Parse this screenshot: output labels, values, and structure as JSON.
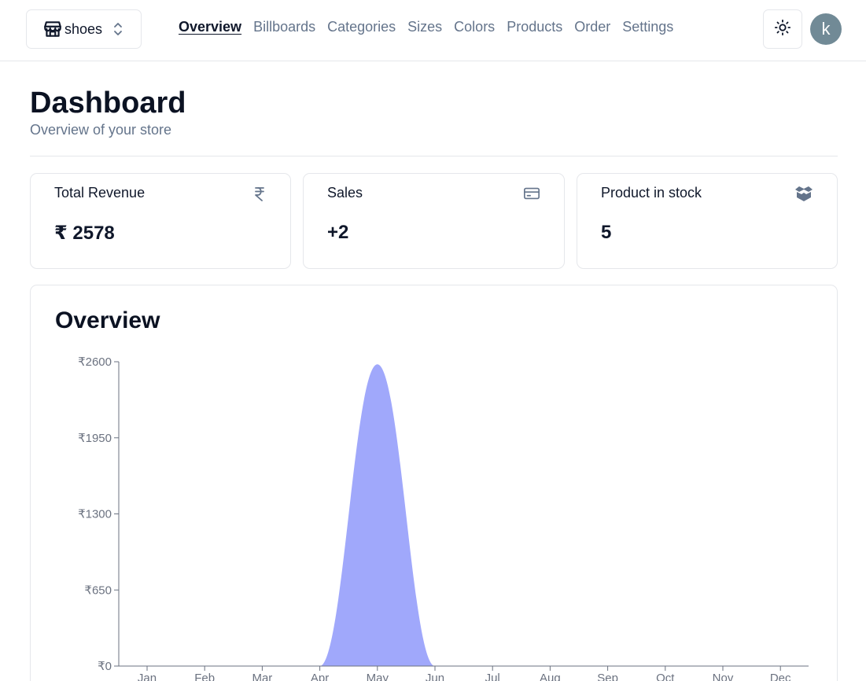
{
  "store_switcher": {
    "name": "shoes",
    "icon": "store-icon"
  },
  "nav": {
    "items": [
      {
        "label": "Overview",
        "active": true
      },
      {
        "label": "Billboards",
        "active": false
      },
      {
        "label": "Categories",
        "active": false
      },
      {
        "label": "Sizes",
        "active": false
      },
      {
        "label": "Colors",
        "active": false
      },
      {
        "label": "Products",
        "active": false
      },
      {
        "label": "Order",
        "active": false
      },
      {
        "label": "Settings",
        "active": false
      }
    ]
  },
  "user": {
    "avatar_letter": "k"
  },
  "header": {
    "title": "Dashboard",
    "subtitle": "Overview of your store"
  },
  "cards": [
    {
      "title": "Total Revenue",
      "value": "₹ 2578",
      "icon": "rupee-icon"
    },
    {
      "title": "Sales",
      "value": "+2",
      "icon": "credit-card-icon"
    },
    {
      "title": "Product in stock",
      "value": "5",
      "icon": "package-icon"
    }
  ],
  "overview": {
    "title": "Overview"
  },
  "chart_data": {
    "type": "area",
    "title": "Overview",
    "categories": [
      "Jan",
      "Feb",
      "Mar",
      "Apr",
      "May",
      "Jun",
      "Jul",
      "Aug",
      "Sep",
      "Oct",
      "Nov",
      "Dec"
    ],
    "values": [
      0,
      0,
      0,
      0,
      2578,
      0,
      0,
      0,
      0,
      0,
      0,
      0
    ],
    "y_ticks": [
      "₹0",
      "₹650",
      "₹1300",
      "₹1950",
      "₹2600"
    ],
    "ylim": [
      0,
      2600
    ],
    "color": "#a0a8fb",
    "grid": false
  }
}
